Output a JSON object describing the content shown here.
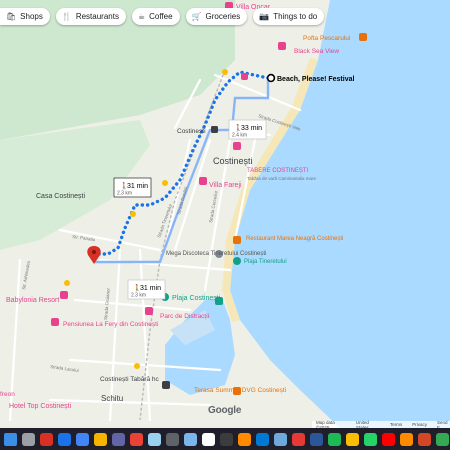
{
  "toolbar": {
    "chips": [
      {
        "label": "Shops",
        "icon": "shop-icon"
      },
      {
        "label": "Restaurants",
        "icon": "restaurant-icon"
      },
      {
        "label": "Coffee",
        "icon": "coffee-icon"
      },
      {
        "label": "Groceries",
        "icon": "cart-icon"
      },
      {
        "label": "Things to do",
        "icon": "camera-icon"
      }
    ]
  },
  "map": {
    "destination": "Beach, Please! Festival",
    "routes": [
      {
        "mode": "walk",
        "time": "31 min",
        "distance": "2.3 km",
        "selected": true
      },
      {
        "mode": "walk",
        "time": "33 min",
        "distance": "2.4 km"
      },
      {
        "mode": "walk",
        "time": "31 min",
        "distance": "2.3 km"
      }
    ],
    "places": {
      "villa_oncar": "Villa Oncar",
      "pofta": "Pofta Pescarului",
      "black_sea_view": "Black Sea View",
      "costinesti_station": "Costinești",
      "costinesti_town": "Costinești",
      "tabere": "TABERE COSTINEȘTI",
      "tabara": "Tabăra de vară Caminantalia mare",
      "villa_fareji": "Villa Fareji",
      "casa": "Casa Costinești",
      "mega": "Mega Discoteca Tineretului Costinești",
      "plaja_tineretului": "Plaja Tineretului",
      "restaurant_marea": "Restaurant Marea Neagră Costinești",
      "plaja_costinesti": "Plaja Costinești",
      "babylonia": "Babylonia Resort",
      "pensiunea": "Pensiunea La Fery din Costinești",
      "parc": "Parc de Distracții",
      "terasa": "Terasa Summer DVG Costinești",
      "tabara_hc": "Costinești Tabără hc",
      "schitu": "Schitu",
      "hotel_top": "Hotel Top Costinești",
      "freon": "freon"
    },
    "streets": {
      "s1": "Strada Costinești Vale",
      "s2": "Strada Tineretului",
      "s3": "Strada Cerceilor",
      "s4": "Str. Panatiu",
      "s5": "Str. Arhimedes",
      "s6": "Strada Gruianor",
      "s7": "Strada Dunării",
      "s8": "Strada Lacului"
    },
    "colors": {
      "route": "#1a73e8",
      "alt_route": "#8ab4f8",
      "water": "#aadaff",
      "park": "#c8e6c9",
      "poi_pink": "#e8428f"
    }
  },
  "attribution": [
    "Map data ©2025",
    "United States",
    "Terms",
    "Privacy",
    "Send F"
  ],
  "logo": "Google",
  "taskbar": {
    "icons": [
      "windows-icon",
      "search-icon",
      "mail-icon",
      "edge-icon",
      "files-icon",
      "folder-icon",
      "teams-icon",
      "chrome-icon",
      "snow-icon",
      "image-icon",
      "camera-icon",
      "settings-icon",
      "terminal-icon",
      "vlc-icon",
      "store-icon",
      "photos-icon",
      "pdf-icon",
      "word-icon",
      "spotify-icon",
      "chrome-icon-2",
      "whatsapp-icon",
      "youtube-icon",
      "vlc-icon-2",
      "powerpoint-icon",
      "chrome-icon-3"
    ],
    "colors": [
      "#3b8ee6",
      "#9aa0a6",
      "#d93025",
      "#1a73e8",
      "#4285f4",
      "#f4b400",
      "#6264a7",
      "#ea4335",
      "#9ad1f0",
      "#5f6368",
      "#7cb5ec",
      "#ffffff",
      "#3c3c3c",
      "#ff8a00",
      "#0078d4",
      "#6fa8dc",
      "#e53935",
      "#2b579a",
      "#1db954",
      "#fbbc04",
      "#25d366",
      "#ff0000",
      "#ff8a00",
      "#d24726",
      "#34a853"
    ]
  }
}
